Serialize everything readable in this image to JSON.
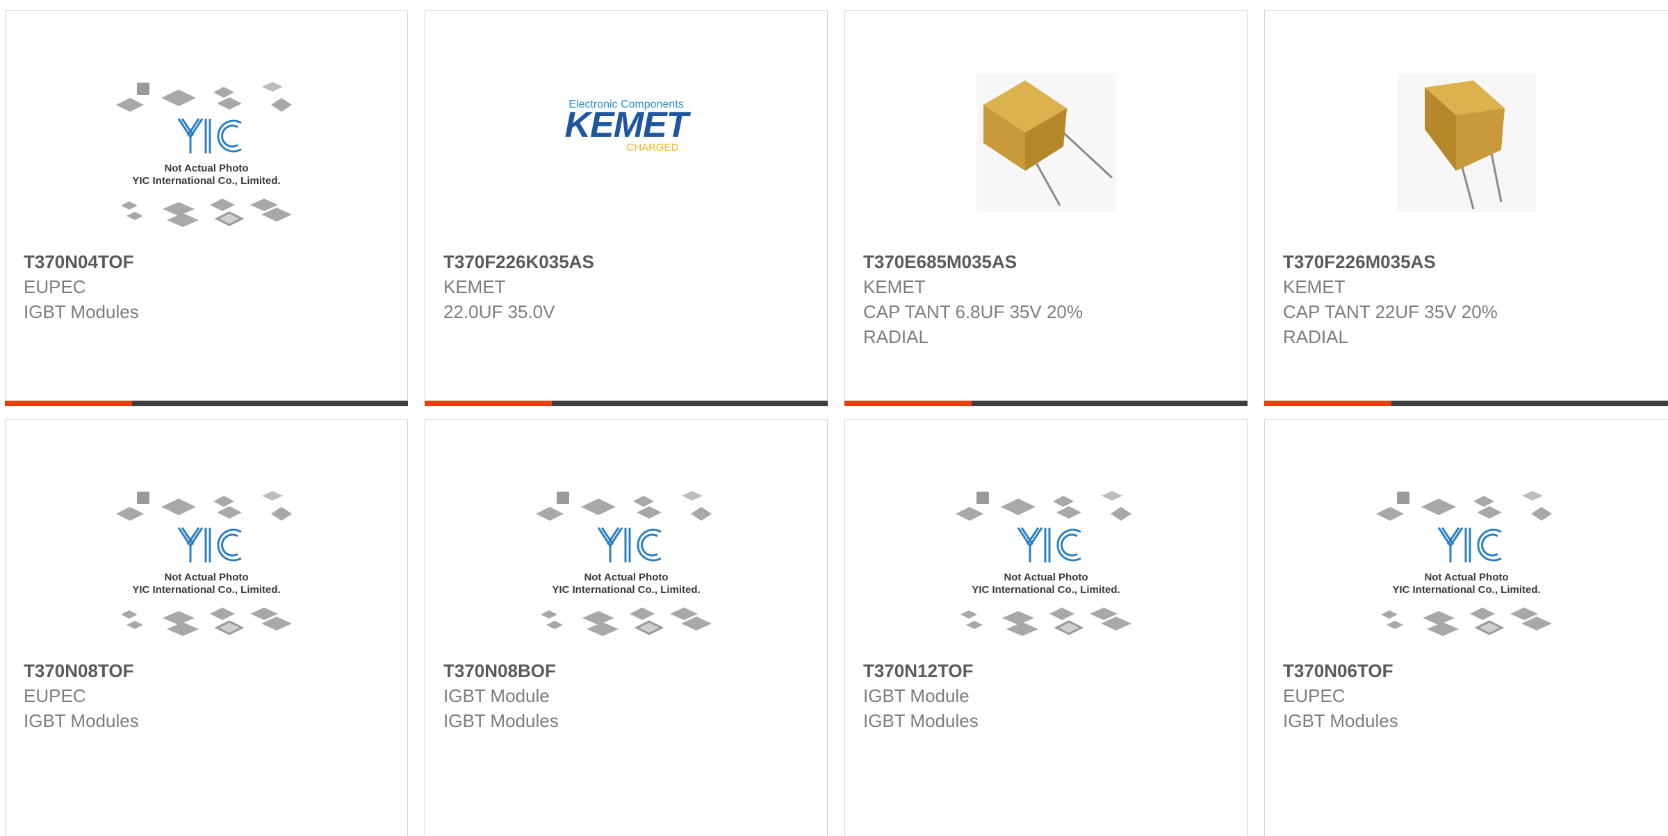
{
  "colors": {
    "accent": "#e5410f",
    "bar": "#3d3d3d",
    "title": "#5a5a5a",
    "text": "#7d7d7d",
    "border": "#d3d3d3",
    "yic_blue": "#2b7fc3",
    "kemet_blue": "#1e56a0",
    "kemet_gold": "#f2b51c"
  },
  "placeholder": {
    "logo": "YIC",
    "line1": "Not Actual Photo",
    "line2": "YIC International Co., Limited."
  },
  "kemet_logo": {
    "tagline": "Electronic Components",
    "name": "KEMET",
    "sub": "CHARGED."
  },
  "products": [
    {
      "part": "T370N04TOF",
      "lines": [
        "EUPEC",
        "IGBT Modules"
      ],
      "image": "yic-placeholder"
    },
    {
      "part": "T370F226K035AS",
      "lines": [
        "KEMET",
        "22.0UF 35.0V"
      ],
      "image": "kemet-logo"
    },
    {
      "part": "T370E685M035AS",
      "lines": [
        "KEMET",
        "CAP TANT 6.8UF 35V 20%",
        "RADIAL"
      ],
      "image": "tantalum-capacitor-photo"
    },
    {
      "part": "T370F226M035AS",
      "lines": [
        "KEMET",
        "CAP TANT 22UF 35V 20%",
        "RADIAL"
      ],
      "image": "tantalum-capacitor-photo"
    },
    {
      "part": "T370N08TOF",
      "lines": [
        "EUPEC",
        "IGBT Modules"
      ],
      "image": "yic-placeholder"
    },
    {
      "part": "T370N08BOF",
      "lines": [
        "IGBT Module",
        "IGBT Modules"
      ],
      "image": "yic-placeholder"
    },
    {
      "part": "T370N12TOF",
      "lines": [
        "IGBT Module",
        "IGBT Modules"
      ],
      "image": "yic-placeholder"
    },
    {
      "part": "T370N06TOF",
      "lines": [
        "EUPEC",
        "IGBT Modules"
      ],
      "image": "yic-placeholder"
    }
  ]
}
